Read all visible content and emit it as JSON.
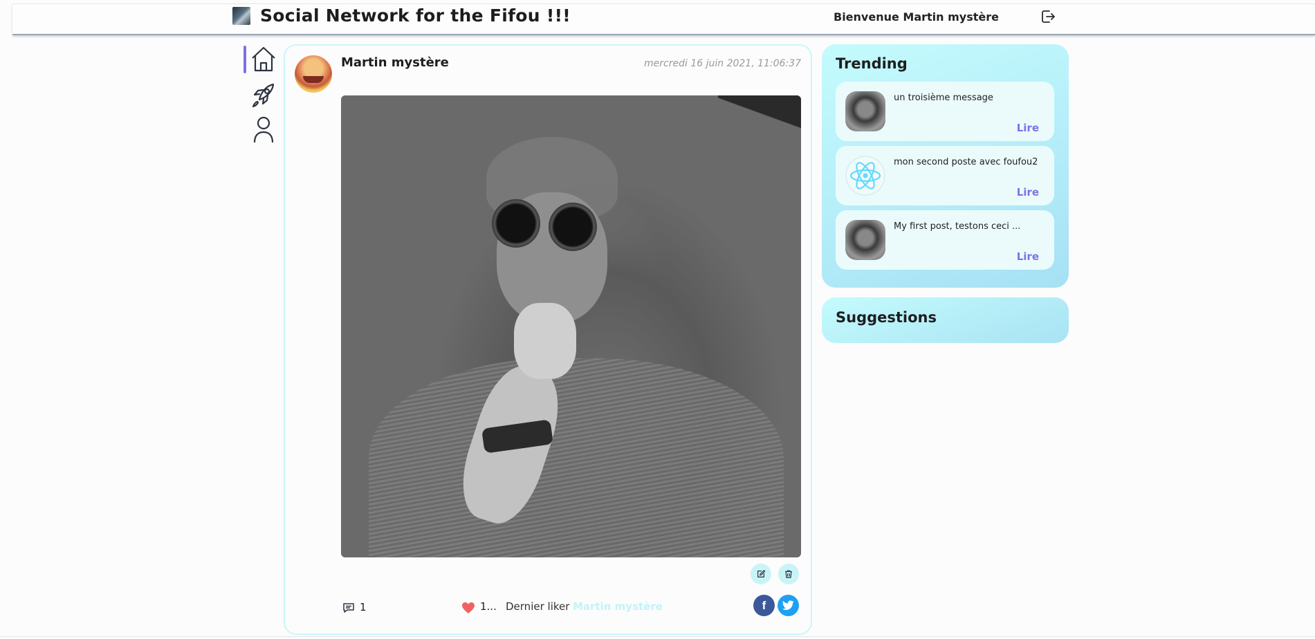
{
  "header": {
    "title": "Social Network for the Fifou !!!",
    "welcome": "Bienvenue Martin mystère"
  },
  "post": {
    "author": "Martin mystère",
    "date": "mercredi 16 juin 2021, 11:06:37",
    "comments_count": "1",
    "likes_count": "1...",
    "last_liker_label": "Dernier liker :",
    "last_liker_name": "Martin mystère"
  },
  "trending": {
    "title": "Trending",
    "items": [
      {
        "text": "un troisième message",
        "read_label": "Lire",
        "thumb": "photo"
      },
      {
        "text": "mon second poste avec foufou2",
        "read_label": "Lire",
        "thumb": "react-logo"
      },
      {
        "text": "My first post, testons ceci ...",
        "read_label": "Lire",
        "thumb": "photo"
      }
    ]
  },
  "suggestions": {
    "title": "Suggestions"
  },
  "colors": {
    "accent": "#7b73e6",
    "panel": "#c4fbfd",
    "facebook": "#3b5998",
    "twitter": "#1da1f2",
    "heart": "#f06262"
  },
  "icons": {
    "nav": [
      "home-icon",
      "rocket-icon",
      "user-icon"
    ],
    "header": "logout-icon",
    "post_actions": [
      "edit-icon",
      "trash-icon",
      "comment-icon",
      "heart-icon",
      "facebook-icon",
      "twitter-icon"
    ]
  }
}
